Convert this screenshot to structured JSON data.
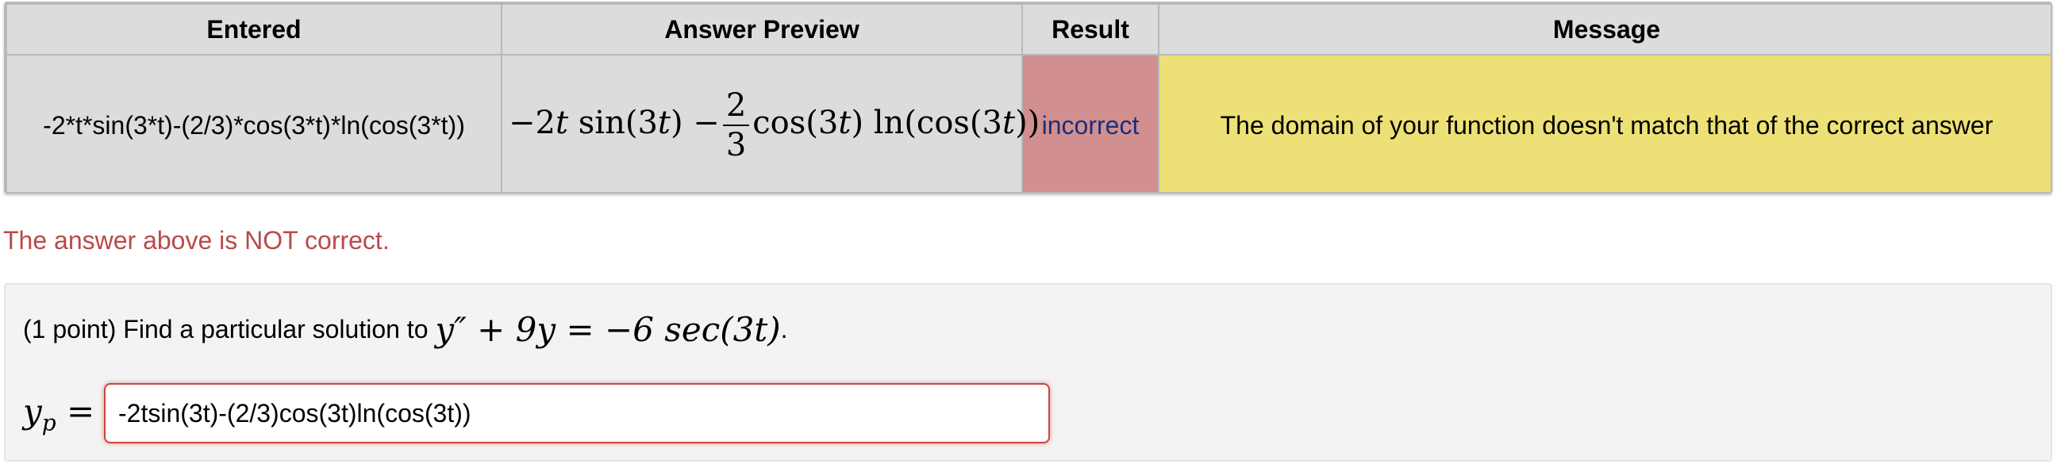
{
  "table": {
    "headers": {
      "entered": "Entered",
      "preview": "Answer Preview",
      "result": "Result",
      "message": "Message"
    },
    "row": {
      "entered": "-2*t*sin(3*t)-(2/3)*cos(3*t)*ln(cos(3*t))",
      "preview": {
        "minus": "−",
        "lead": "2",
        "t1": "t",
        "sin": " sin(3",
        "t2": "t",
        "close1": ") −",
        "frac_num": "2",
        "frac_den": "3",
        "cos": "cos(3",
        "t3": "t",
        "ln": ") ln(cos(3",
        "t4": "t",
        "close2": "))"
      },
      "result": "incorrect",
      "message": "The domain of your function doesn't match that of the correct answer"
    }
  },
  "feedback": "The answer above is NOT correct.",
  "problem": {
    "prefix": "(1 point) Find a particular solution to",
    "equation": "y″ + 9y = −6 sec(3t)",
    "period": ".",
    "answer_label_base": "y",
    "answer_label_sub": "p",
    "answer_label_eq": " =",
    "answer_value": "-2tsin(3t)-(2/3)cos(3t)ln(cos(3t))"
  },
  "colors": {
    "result_incorrect_bg": "#d18f8f",
    "message_bg": "#ece077",
    "feedback_text": "#b94a48",
    "input_error_border": "#c9463d"
  }
}
